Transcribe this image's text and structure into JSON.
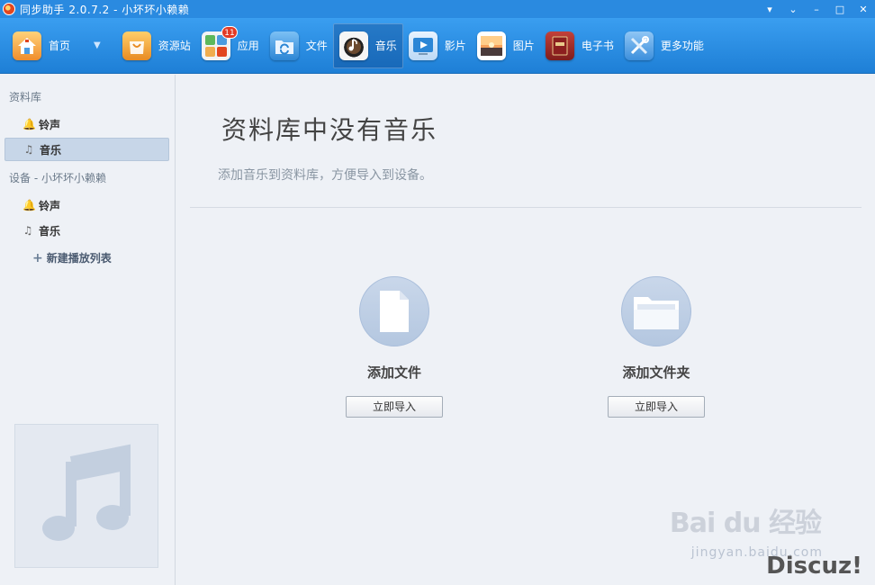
{
  "window": {
    "title": "同步助手 2.0.7.2 - 小坏坏小赖赖",
    "controls": [
      "▾",
      "⌄",
      "–",
      "□",
      "✕"
    ]
  },
  "toolbar": {
    "items": [
      {
        "label": "首页",
        "icon": "home-icon",
        "color": "#f3a33a"
      },
      {
        "label": "资源站",
        "icon": "shopping-bag-icon",
        "color": "#f0a83c"
      },
      {
        "label": "应用",
        "icon": "apps-icon",
        "color": "#f5f5f5",
        "badge": "11"
      },
      {
        "label": "文件",
        "icon": "file-folder-icon",
        "color": "#4aa0e6"
      },
      {
        "label": "音乐",
        "icon": "music-icon",
        "color": "#333333"
      },
      {
        "label": "影片",
        "icon": "video-icon",
        "color": "#2b86d6"
      },
      {
        "label": "图片",
        "icon": "picture-icon",
        "color": "#d98a45"
      },
      {
        "label": "电子书",
        "icon": "ebook-icon",
        "color": "#a22a2a"
      },
      {
        "label": "更多功能",
        "icon": "tools-icon",
        "color": "#5aa7e8"
      }
    ],
    "active_index": 4
  },
  "sidebar": {
    "library_header": "资料库",
    "library_items": [
      {
        "label": "铃声",
        "icon": "bell-icon"
      },
      {
        "label": "音乐",
        "icon": "music-note-icon"
      }
    ],
    "device_header": "设备 - 小坏坏小赖赖",
    "device_items": [
      {
        "label": "铃声",
        "icon": "bell-icon"
      },
      {
        "label": "音乐",
        "icon": "music-note-icon"
      }
    ],
    "new_playlist": "新建播放列表"
  },
  "main": {
    "title": "资料库中没有音乐",
    "subtitle": "添加音乐到资料库，方便导入到设备。",
    "cards": [
      {
        "label": "添加文件",
        "button": "立即导入",
        "icon": "file-icon"
      },
      {
        "label": "添加文件夹",
        "button": "立即导入",
        "icon": "folder-icon"
      }
    ]
  },
  "watermark": {
    "baidu": "Bai du 经验",
    "site": "jingyan.baidu.com",
    "discuz": "Discuz!"
  }
}
